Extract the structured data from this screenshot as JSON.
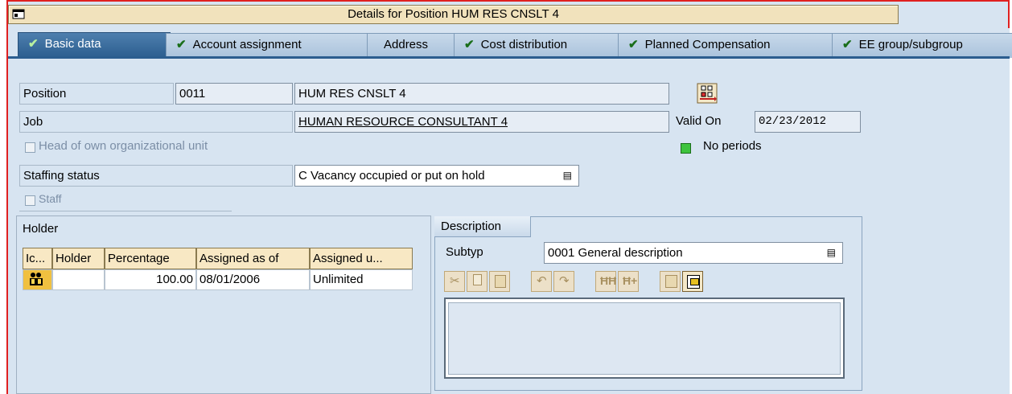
{
  "window": {
    "title": "Details for Position HUM RES CNSLT 4"
  },
  "tabs": [
    {
      "label": "Basic data",
      "checked": true,
      "active": true
    },
    {
      "label": "Account assignment",
      "checked": true
    },
    {
      "label": "Address",
      "checked": false
    },
    {
      "label": "Cost distribution",
      "checked": true
    },
    {
      "label": "Planned Compensation",
      "checked": true
    },
    {
      "label": "EE group/subgroup",
      "checked": true
    }
  ],
  "form": {
    "position_label": "Position",
    "position_id": "0011",
    "position_name": "HUM RES CNSLT 4",
    "job_label": "Job",
    "job_name": "HUMAN RESOURCE CONSULTANT 4",
    "valid_on_label": "Valid On",
    "valid_on_value": "02/23/2012",
    "head_of_unit_label": "Head of own organizational unit",
    "no_periods_label": "No periods",
    "staffing_status_label": "Staffing status",
    "staffing_status_value": "C Vacancy occupied or put on hold",
    "staff_label": "Staff"
  },
  "holder": {
    "title": "Holder",
    "columns": [
      "Ic...",
      "Holder",
      "Percentage",
      "Assigned as of",
      "Assigned u..."
    ],
    "rows": [
      {
        "icon": "holder-icon",
        "holder": "",
        "percentage": "100.00",
        "assigned_as_of": "08/01/2006",
        "assigned_until": "Unlimited"
      }
    ]
  },
  "description": {
    "tab_label": "Description",
    "subtype_label": "Subtyp",
    "subtype_value": "0001 General description",
    "text": ""
  },
  "colors": {
    "frame": "#e02020",
    "title_bar": "#f1e2bc",
    "active_tab": "#2b5d8f",
    "background": "#d7e4f1",
    "check": "#1a6e1a",
    "status_green": "#3ec43e"
  }
}
